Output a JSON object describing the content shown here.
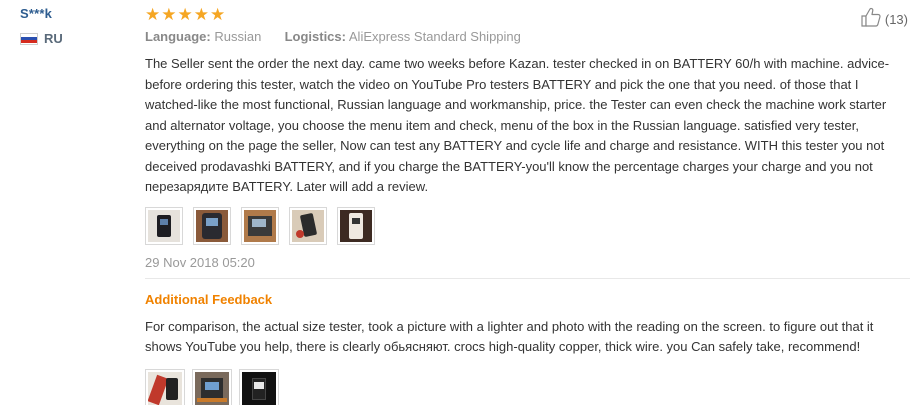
{
  "user": {
    "name": "S***k",
    "country_code": "RU",
    "flag_icon": "russia-flag-icon"
  },
  "review": {
    "rating": 5,
    "stars": [
      "★",
      "★",
      "★",
      "★",
      "★"
    ],
    "language_label": "Language:",
    "language_value": "Russian",
    "logistics_label": "Logistics:",
    "logistics_value": "AliExpress Standard Shipping",
    "text": "The Seller sent the order the next day. came two weeks before Kazan. tester checked in on BATTERY 60/h with machine. advice-before ordering this tester, watch the video on YouTube Pro testers BATTERY and pick the one that you need. of those that I watched-like the most functional, Russian language and workmanship, price. the Tester can even check the machine work starter and alternator voltage, you choose the menu item and check, menu of the box in the Russian language. satisfied very tester, everything on the page the seller, Now can test any BATTERY and cycle life and charge and resistance. WITH this tester you not deceived prodavashki BATTERY, and if you charge the BATTERY-you'll know the percentage charges your charge and you not перезарядите BATTERY. Later will add a review.",
    "photo_count": 5,
    "date": "29 Nov 2018 05:20",
    "helpful_icon": "thumbs-up-icon",
    "helpful_count": "(13)"
  },
  "additional_feedback": {
    "title": "Additional Feedback",
    "text": "For comparison, the actual size tester, took a picture with a lighter and photo with the reading on the screen. to figure out that it shows YouTube you help, there is clearly обьясняют. crocs high-quality copper, thick wire. you Can safely take, recommend!",
    "photo_count": 3
  },
  "colors": {
    "star": "#f5a623",
    "username": "#2d5c8f",
    "additional_feedback_title": "#f08200",
    "meta_text": "#999999"
  }
}
